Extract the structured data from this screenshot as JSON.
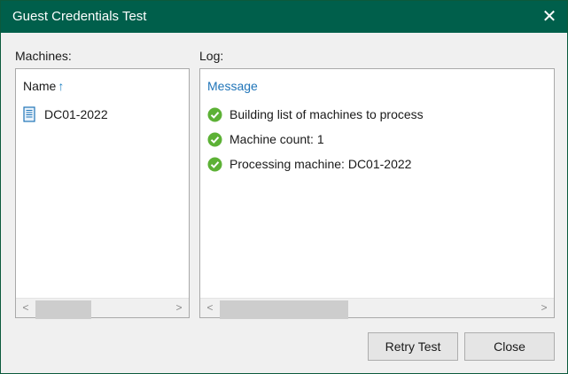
{
  "window": {
    "title": "Guest Credentials Test",
    "close_glyph": "✕",
    "accent": "#005f4b"
  },
  "machines": {
    "label": "Machines:",
    "column_header": "Name",
    "sort_glyph": "↑",
    "items": [
      {
        "name": "DC01-2022",
        "icon": "server-icon"
      }
    ]
  },
  "log": {
    "label": "Log:",
    "column_header": "Message",
    "items": [
      {
        "text": "Building list of machines to process",
        "status": "success",
        "icon": "check-circle-icon"
      },
      {
        "text": "Machine count: 1",
        "status": "success",
        "icon": "check-circle-icon"
      },
      {
        "text": "Processing machine: DC01-2022",
        "status": "success",
        "icon": "check-circle-icon"
      }
    ]
  },
  "scroll": {
    "left_glyph": "<",
    "right_glyph": ">"
  },
  "buttons": {
    "retry_label": "Retry Test",
    "close_label": "Close"
  },
  "colors": {
    "success": "#5cb135",
    "link": "#1f74b8"
  }
}
